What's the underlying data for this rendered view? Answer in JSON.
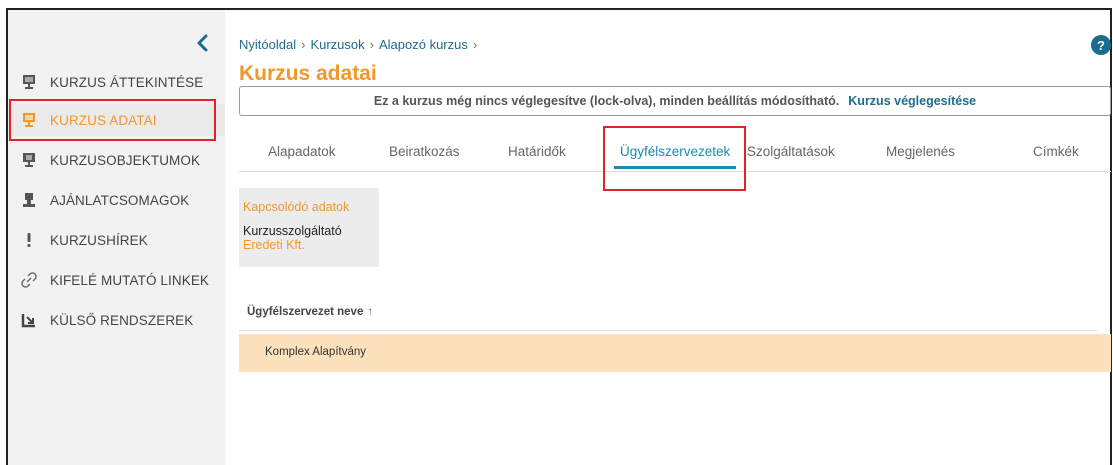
{
  "sidebar": {
    "items": [
      {
        "label": "KURZUS ÁTTEKINTÉSE",
        "icon": "presentation-icon"
      },
      {
        "label": "KURZUS ADATAI",
        "icon": "presentation-icon"
      },
      {
        "label": "KURZUSOBJEKTUMOK",
        "icon": "presentation-icon"
      },
      {
        "label": "AJÁNLATCSOMAGOK",
        "icon": "package-icon"
      },
      {
        "label": "KURZUSHÍREK",
        "icon": "exclamation-icon"
      },
      {
        "label": "KIFELÉ MUTATÓ LINKEK",
        "icon": "link-icon"
      },
      {
        "label": "KÜLSŐ RENDSZEREK",
        "icon": "external-arrow-icon"
      }
    ]
  },
  "breadcrumb": {
    "items": [
      "Nyitóoldal",
      "Kurzusok",
      "Alapozó kurzus"
    ],
    "separator": "›"
  },
  "page": {
    "title": "Kurzus adatai",
    "help": "?"
  },
  "notice": {
    "text": "Ez a kurzus még nincs véglegesítve (lock-olva), minden beállítás módosítható.",
    "link": "Kurzus véglegesítése"
  },
  "tabs": [
    {
      "label": "Alapadatok"
    },
    {
      "label": "Beiratkozás"
    },
    {
      "label": "Határidők"
    },
    {
      "label": "Ügyfélszervezetek",
      "active": true
    },
    {
      "label": "Szolgáltatások"
    },
    {
      "label": "Megjelenés"
    },
    {
      "label": "Címkék"
    }
  ],
  "related": {
    "title": "Kapcsolódó adatok",
    "label": "Kurzusszolgáltató",
    "value": "Eredeti Kft."
  },
  "table": {
    "header": "Ügyfélszervezet neve",
    "sort_arrow": "↑",
    "rows": [
      "Komplex Alapítvány"
    ]
  },
  "colors": {
    "accent_orange": "#f0982b",
    "link_blue": "#1f6b8c",
    "active_tab": "#1a8bb3",
    "highlight_red": "#e2212a",
    "row_highlight": "#fbe2bd"
  }
}
